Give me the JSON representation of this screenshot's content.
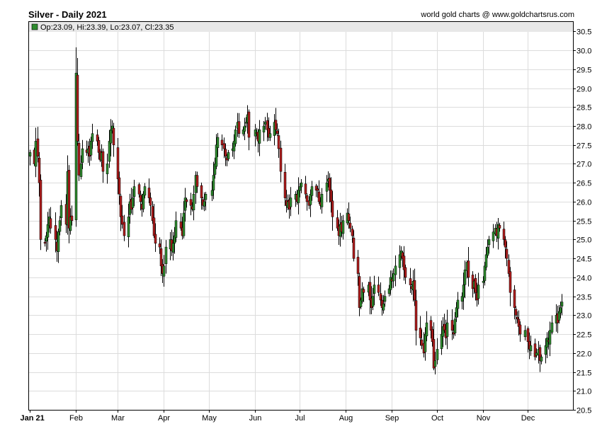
{
  "chart_title": "Silver - Daily 2021",
  "credit": "world gold charts @ www.goldchartsrus.com",
  "info": {
    "open_label": "Op",
    "open": "23.09",
    "high_label": "Hi",
    "high": "23.39",
    "low_label": "Lo",
    "low": "23.07",
    "close_label": "Cl",
    "close": "23.35"
  },
  "colors": {
    "up": "#2e8b2e",
    "down": "#b01c1c",
    "grid": "#dcdcdc",
    "info_bar": "#e8e8e8"
  },
  "chart_data": {
    "type": "candlestick",
    "title": "Silver - Daily 2021",
    "xlabel": "",
    "ylabel": "",
    "ylim": [
      20.5,
      30.75
    ],
    "xlim": [
      "2021-01-01",
      "2021-12-31"
    ],
    "y_ticks": [
      "20.5",
      "21.0",
      "21.5",
      "22.0",
      "22.5",
      "23.0",
      "23.5",
      "24.0",
      "24.5",
      "25.0",
      "25.5",
      "26.0",
      "26.5",
      "27.0",
      "27.5",
      "28.0",
      "28.5",
      "29.0",
      "29.5",
      "30.0",
      "30.5"
    ],
    "x_ticks": [
      {
        "date": "2021-01-01",
        "label": "Jan 21"
      },
      {
        "date": "2021-02-01",
        "label": "Feb"
      },
      {
        "date": "2021-03-01",
        "label": "Mar"
      },
      {
        "date": "2021-04-01",
        "label": "Apr"
      },
      {
        "date": "2021-05-01",
        "label": "May"
      },
      {
        "date": "2021-06-01",
        "label": "Jun"
      },
      {
        "date": "2021-07-01",
        "label": "Jul"
      },
      {
        "date": "2021-08-01",
        "label": "Aug"
      },
      {
        "date": "2021-09-01",
        "label": "Sep"
      },
      {
        "date": "2021-10-01",
        "label": "Oct"
      },
      {
        "date": "2021-11-01",
        "label": "Nov"
      },
      {
        "date": "2021-12-01",
        "label": "Dec"
      }
    ],
    "grid": true,
    "legend": "top-left",
    "monthly_closes": [
      {
        "month": "2021-01",
        "values": [
          27.3,
          27.0,
          27.6,
          27.2,
          26.5,
          25.0,
          24.9,
          25.1,
          25.4,
          25.6,
          25.3,
          25.0,
          24.7,
          25.2,
          25.5,
          25.9,
          25.4,
          26.8,
          25.3,
          25.6,
          25.5
        ]
      },
      {
        "month": "2021-02",
        "values": [
          29.4,
          27.6,
          26.7,
          27.0,
          27.4,
          27.3,
          27.4,
          27.2,
          27.6,
          27.8,
          27.6,
          27.3,
          27.1,
          27.3,
          26.8,
          27.0,
          27.6,
          27.9,
          28.0,
          27.5
        ]
      },
      {
        "month": "2021-03",
        "values": [
          26.6,
          26.2,
          25.6,
          25.4,
          25.1,
          25.6,
          26.0,
          25.8,
          26.1,
          26.4,
          26.2,
          26.0,
          25.8,
          26.2,
          26.4,
          26.1,
          25.9,
          25.5,
          25.1,
          24.9,
          24.8,
          24.3,
          24.1
        ]
      },
      {
        "month": "2021-04",
        "values": [
          24.3,
          24.8,
          25.0,
          24.7,
          24.9,
          25.1,
          25.5,
          25.3,
          25.1,
          25.7,
          26.1,
          26.0,
          25.9,
          25.8,
          26.2,
          26.7,
          26.4,
          26.1,
          25.9,
          26.0,
          26.2
        ]
      },
      {
        "month": "2021-05",
        "values": [
          26.3,
          26.7,
          27.0,
          27.5,
          27.7,
          27.5,
          27.4,
          27.2,
          27.1,
          27.3,
          27.4,
          27.6,
          27.9,
          28.1,
          27.8,
          27.9,
          28.0,
          28.1,
          28.3,
          27.7
        ]
      },
      {
        "month": "2021-06",
        "values": [
          27.9,
          27.8,
          27.6,
          27.9,
          28.0,
          28.1,
          27.9,
          27.7,
          27.8,
          28.1,
          27.9,
          27.8,
          27.4,
          26.8,
          26.1,
          25.9,
          26.0,
          25.8,
          26.1,
          26.2,
          26.0,
          26.3
        ]
      },
      {
        "month": "2021-07",
        "values": [
          26.4,
          26.5,
          26.2,
          26.0,
          25.9,
          26.2,
          26.4,
          26.3,
          26.3,
          26.0,
          25.9,
          26.2,
          26.5,
          26.6,
          26.3,
          26.0,
          25.6,
          25.3,
          25.1,
          25.4,
          25.2,
          25.5
        ]
      },
      {
        "month": "2021-08",
        "values": [
          25.7,
          25.5,
          25.3,
          25.1,
          24.5,
          24.1,
          23.2,
          23.4,
          23.7,
          23.6,
          23.8,
          23.4,
          23.2,
          23.5,
          23.8,
          23.6,
          23.4,
          23.2,
          23.3,
          23.5,
          23.7,
          24.0
        ]
      },
      {
        "month": "2021-09",
        "values": [
          23.9,
          24.1,
          24.3,
          24.6,
          24.7,
          24.5,
          24.2,
          24.0,
          23.8,
          23.7,
          23.9,
          23.4,
          22.6,
          22.4,
          22.2,
          22.0,
          22.5,
          22.8,
          22.6,
          22.3,
          21.6,
          21.8
        ]
      },
      {
        "month": "2021-10",
        "values": [
          22.1,
          22.5,
          22.7,
          22.6,
          22.4,
          22.8,
          22.6,
          22.5,
          22.9,
          23.2,
          23.4,
          23.5,
          23.8,
          24.2,
          24.4,
          24.0,
          23.7,
          23.9,
          23.6,
          23.4,
          23.8
        ]
      },
      {
        "month": "2021-11",
        "values": [
          23.9,
          24.3,
          24.6,
          24.8,
          25.0,
          25.2,
          25.3,
          25.1,
          25.4,
          25.3,
          25.0,
          24.8,
          24.5,
          24.1,
          23.6,
          23.2,
          23.0,
          22.9,
          22.7,
          22.5,
          22.6
        ]
      },
      {
        "month": "2021-12",
        "values": [
          22.3,
          22.1,
          22.2,
          21.9,
          22.0,
          22.1,
          21.8,
          21.9,
          22.2,
          22.4,
          22.3,
          22.6,
          22.8,
          23.0,
          22.8,
          23.1,
          23.2,
          23.35
        ]
      }
    ]
  }
}
